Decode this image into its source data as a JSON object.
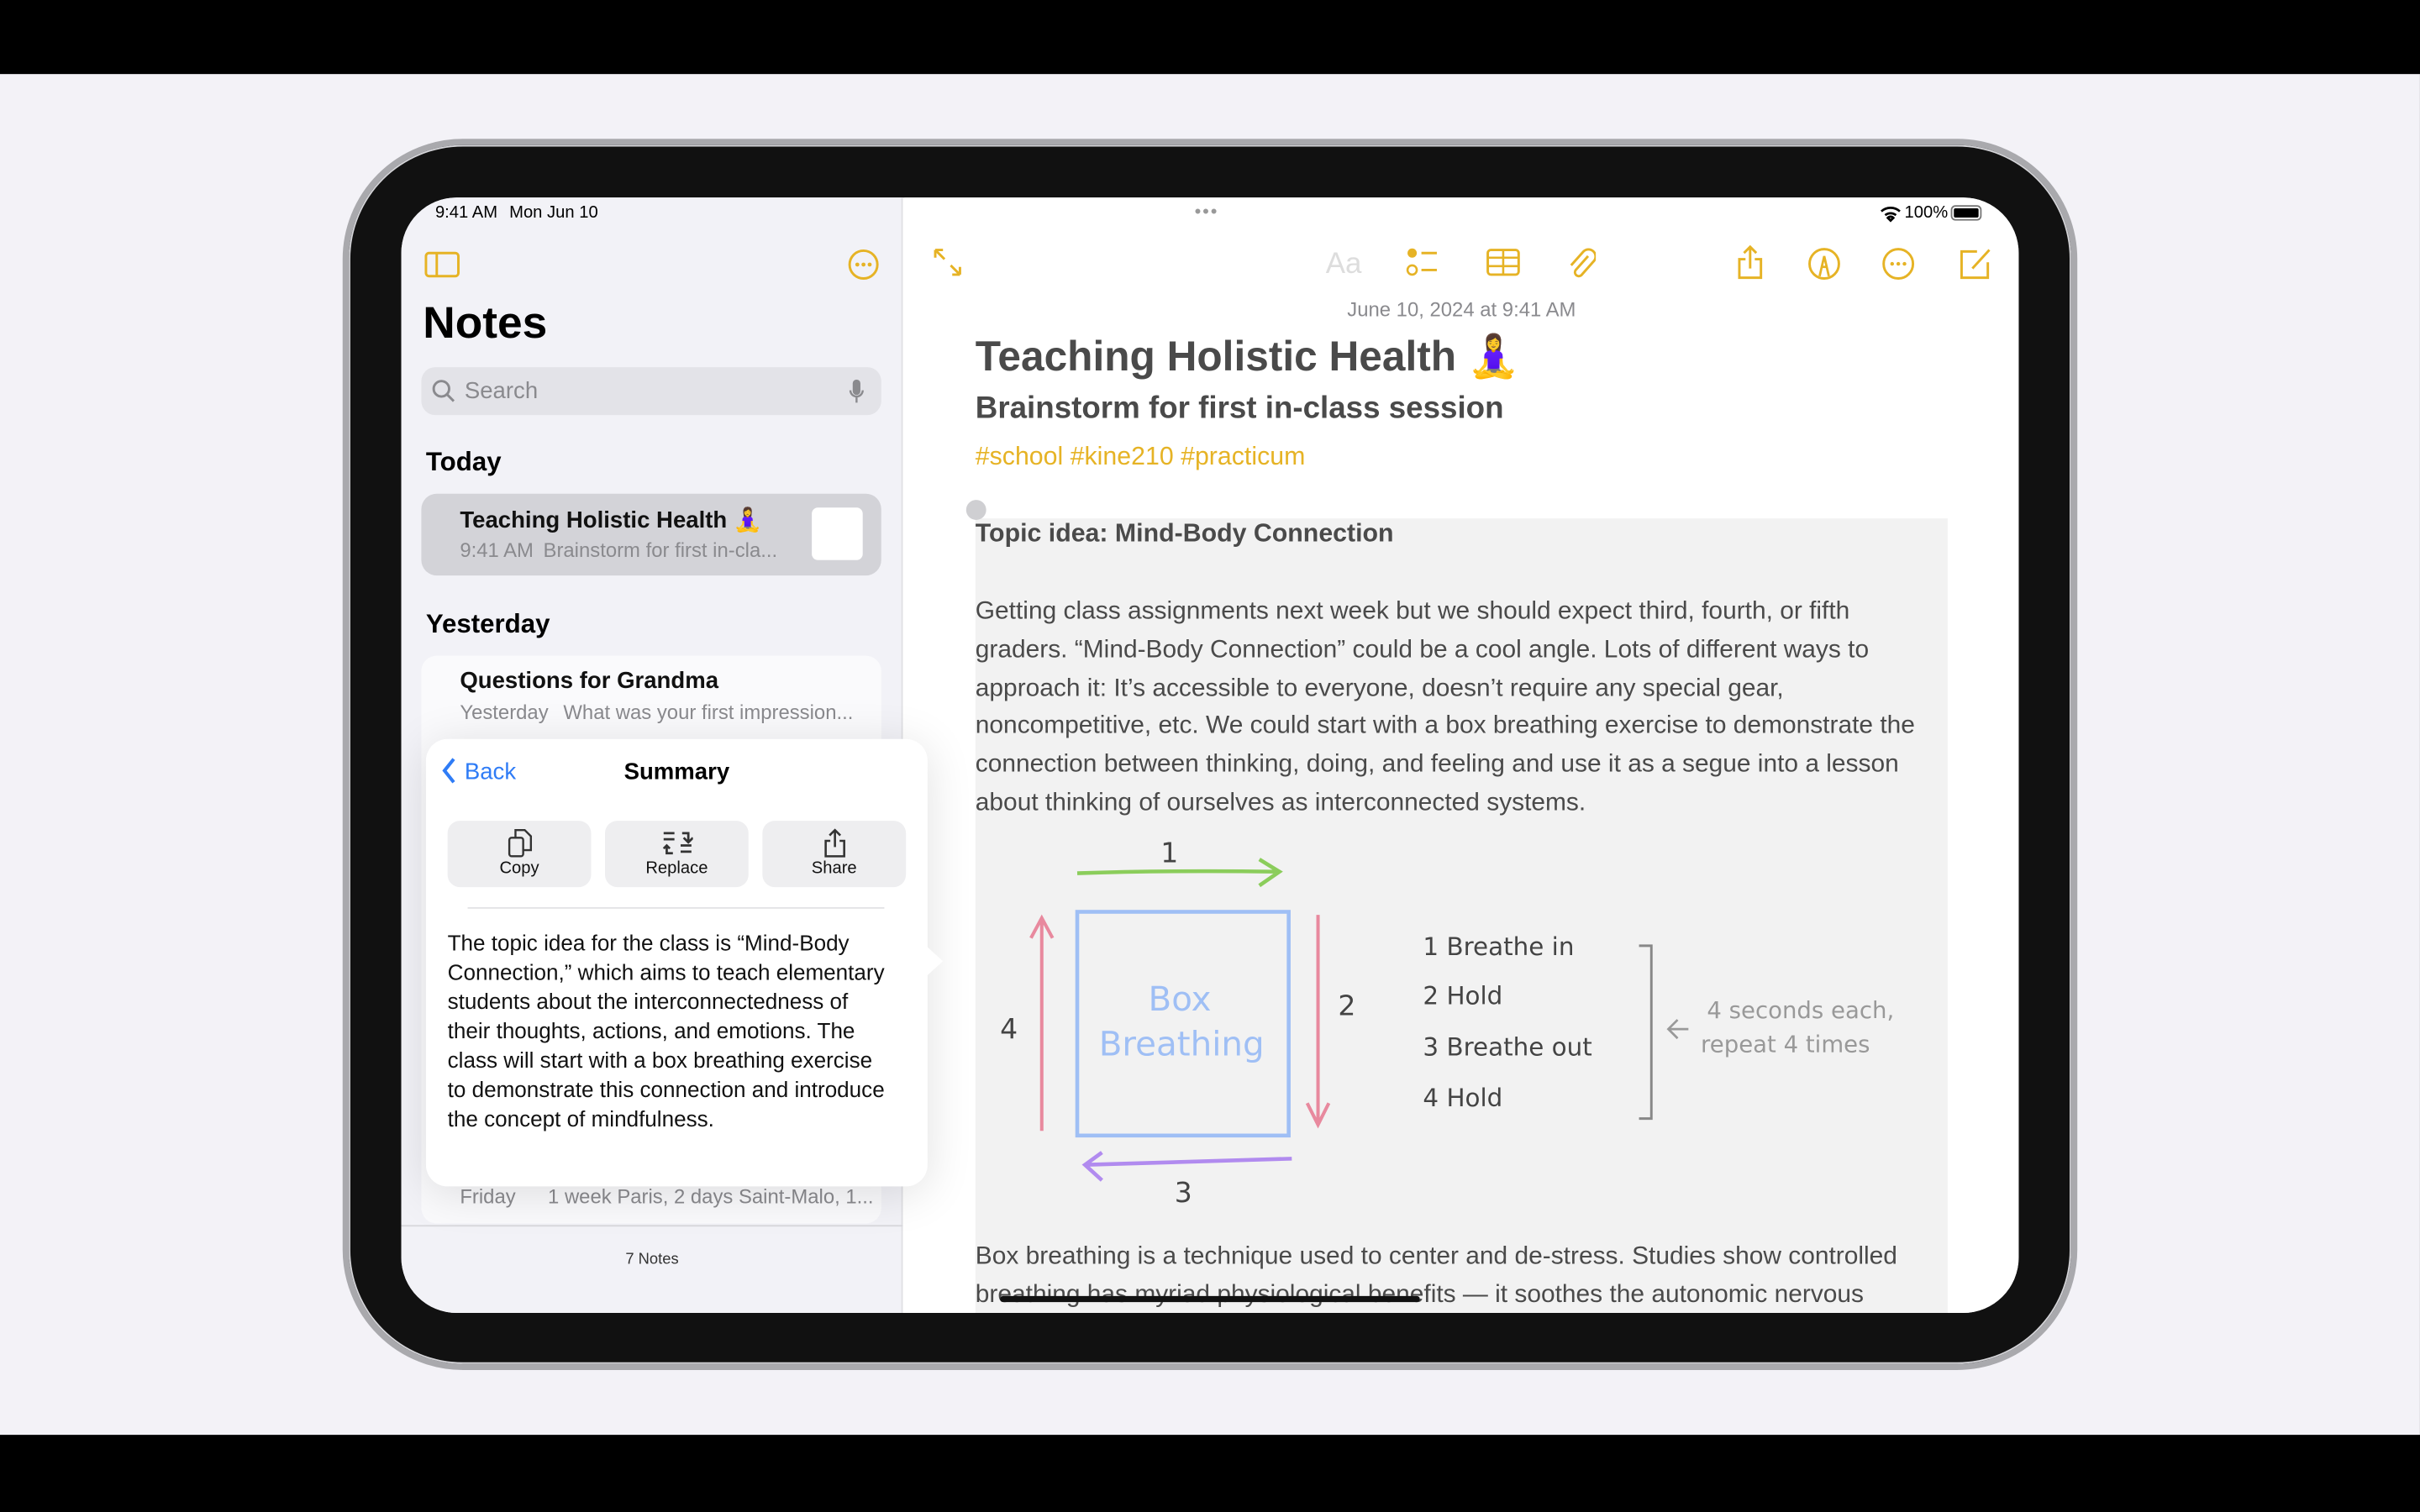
{
  "status_bar": {
    "time": "9:41 AM",
    "date": "Mon Jun 10",
    "battery": "100%"
  },
  "sidebar": {
    "title": "Notes",
    "search_placeholder": "Search",
    "sections": [
      {
        "label": "Today",
        "notes": [
          {
            "title": "Teaching Holistic Health 🧘‍♀️",
            "time": "9:41 AM",
            "preview": "Brainstorm for first in-cla..."
          }
        ]
      },
      {
        "label": "Yesterday",
        "notes": [
          {
            "title": "Questions for Grandma",
            "time": "Yesterday",
            "preview": "What was your first impression..."
          }
        ]
      }
    ],
    "partial_note": {
      "time": "Friday",
      "preview": "1 week Paris, 2 days Saint-Malo, 1..."
    },
    "footer": "7 Notes"
  },
  "summary_popover": {
    "back_label": "Back",
    "title": "Summary",
    "actions": [
      {
        "label": "Copy",
        "icon": "copy-icon"
      },
      {
        "label": "Replace",
        "icon": "replace-icon"
      },
      {
        "label": "Share",
        "icon": "share-icon"
      }
    ],
    "text": "The topic idea for the class is “Mind-Body Connection,” which aims to teach elementary students about the interconnectedness of their thoughts, actions, and emotions. The class will start with a box breathing exercise to demonstrate this connection and introduce the concept of mindfulness."
  },
  "editor": {
    "toolbar_icons": [
      "expand-icon",
      "text-format-icon",
      "checklist-icon",
      "table-icon",
      "attachment-icon",
      "share-icon",
      "markup-icon",
      "more-icon",
      "compose-icon"
    ],
    "format_label": "Aa",
    "timestamp": "June 10, 2024 at 9:41 AM",
    "title": "Teaching Holistic Health 🧘‍♀️",
    "subtitle": "Brainstorm for first in-class session",
    "tags": "#school #kine210 #practicum",
    "topic_heading": "Topic idea: Mind-Body Connection",
    "paragraph1": "Getting class assignments next week but we should expect third, fourth, or fifth graders. “Mind-Body Connection” could be a cool angle. Lots of different ways to approach it: It’s accessible to everyone, doesn’t require any special gear, noncompetitive, etc. We could start with a box breathing exercise to demonstrate the connection between thinking, doing, and feeling and use it as a segue into a lesson about thinking of ourselves as interconnected systems.",
    "drawing": {
      "box_label_1": "Box",
      "box_label_2": "Breathing",
      "side_numbers": [
        "1",
        "2",
        "3",
        "4"
      ],
      "steps": [
        "1  Breathe in",
        "2  Hold",
        "3  Breathe out",
        "4  Hold"
      ],
      "note_1": "4 seconds each,",
      "note_2": "repeat 4 times"
    },
    "paragraph2": "Box breathing is a technique used to center and de-stress. Studies show controlled breathing has myriad physiological benefits — it soothes the autonomic nervous"
  },
  "colors": {
    "accent": "#e6b325",
    "link": "#2f7cf6"
  }
}
